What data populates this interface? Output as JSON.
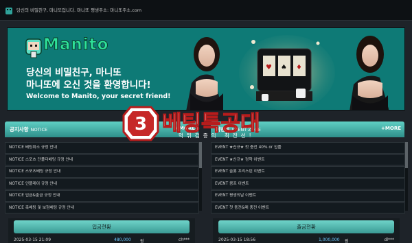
{
  "top": {
    "tagline": "당신의 비밀친구, 마니또입니다. 마니또 평생주소: 마니또주소.com"
  },
  "banner": {
    "logo_text": "Manito",
    "line1": "당신의 비밀친구, 마니또",
    "line2": "마니또에 오신 것을 환영합니다!",
    "line3": "Welcome to Manito, your secret friend!"
  },
  "emblem": {
    "title": "베팅특공대",
    "subtitle": "먹튀검증의 최전선!"
  },
  "notice_panel": {
    "title": "공지사항",
    "sub": "NOTICE",
    "more": "+MORE",
    "items": [
      "NOTICE 베팅취소 규정 안내",
      "NOTICE 스포츠 단폴더베팅 규정 안내",
      "NOTICE 스포츠베팅 규정 안내",
      "NOTICE 인플레이 규정 안내",
      "NOTICE 입금&출금 규정 안내",
      "NOTICE 축베팅 및 보험베팅 규정 안내"
    ]
  },
  "event_panel": {
    "title": "이벤트",
    "sub": "EVENT ZONE",
    "more": "+MORE",
    "items": [
      "EVENT ★신규★ 첫 충전 40% or 입플",
      "EVENT ★신규★ 정착 이벤트",
      "EVENT 슬롯 프리스핀 이벤트",
      "EVENT 콤프 이벤트",
      "EVENT 평생의날 이벤트",
      "EVENT 첫 충전&매 충전 이벤트"
    ]
  },
  "deposit": {
    "title": "입금현황",
    "date": "2025-03-15 21:09",
    "amount": "480,000",
    "unit": "원",
    "user": "ch***"
  },
  "withdraw": {
    "title": "출금현황",
    "date": "2025-03-15 18:56",
    "amount": "1,000,000",
    "unit": "원",
    "user": "dl***"
  },
  "colors": {
    "accent": "#3fb4aa",
    "banner_bg": "#0e7a76",
    "page_bg": "#1e2329",
    "logo_green": "#2ee29a",
    "amount_blue": "#6cc8ff"
  }
}
